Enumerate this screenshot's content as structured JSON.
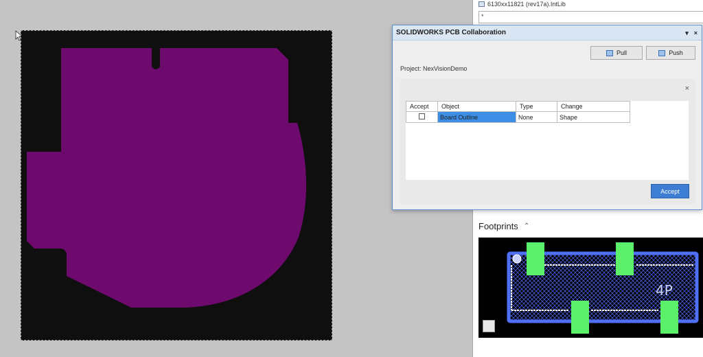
{
  "library": {
    "file_name": "6130xx11821 (rev17a).IntLib",
    "filter_text": "*"
  },
  "dialog": {
    "title": "SOLIDWORKS PCB Collaboration",
    "pin_glyph": "▾",
    "close_glyph": "×",
    "pull_label": "Pull",
    "push_label": "Push",
    "project_label": "Project: NexVisionDemo",
    "panel_close_glyph": "×",
    "table": {
      "headers": [
        "Accept",
        "Object",
        "Type",
        "Change"
      ],
      "rows": [
        {
          "accepted": false,
          "object": "Board Outline",
          "type": "None",
          "change": "Shape"
        }
      ]
    },
    "accept_button": "Accept"
  },
  "footprints": {
    "label": "Footprints",
    "toggle_glyph": "⌃",
    "designator": "4P"
  },
  "colors": {
    "board_fill": "#6e0a6e",
    "board_background": "#0f0f0f",
    "pad": "#5cf06a",
    "outline": "#4f6ff5",
    "selection_blue": "#3c8ee6"
  },
  "icons": [
    "cursor-arrow-icon",
    "library-icon",
    "pull-icon",
    "push-icon",
    "close-icon",
    "chevron-up-icon",
    "tool-icon"
  ]
}
